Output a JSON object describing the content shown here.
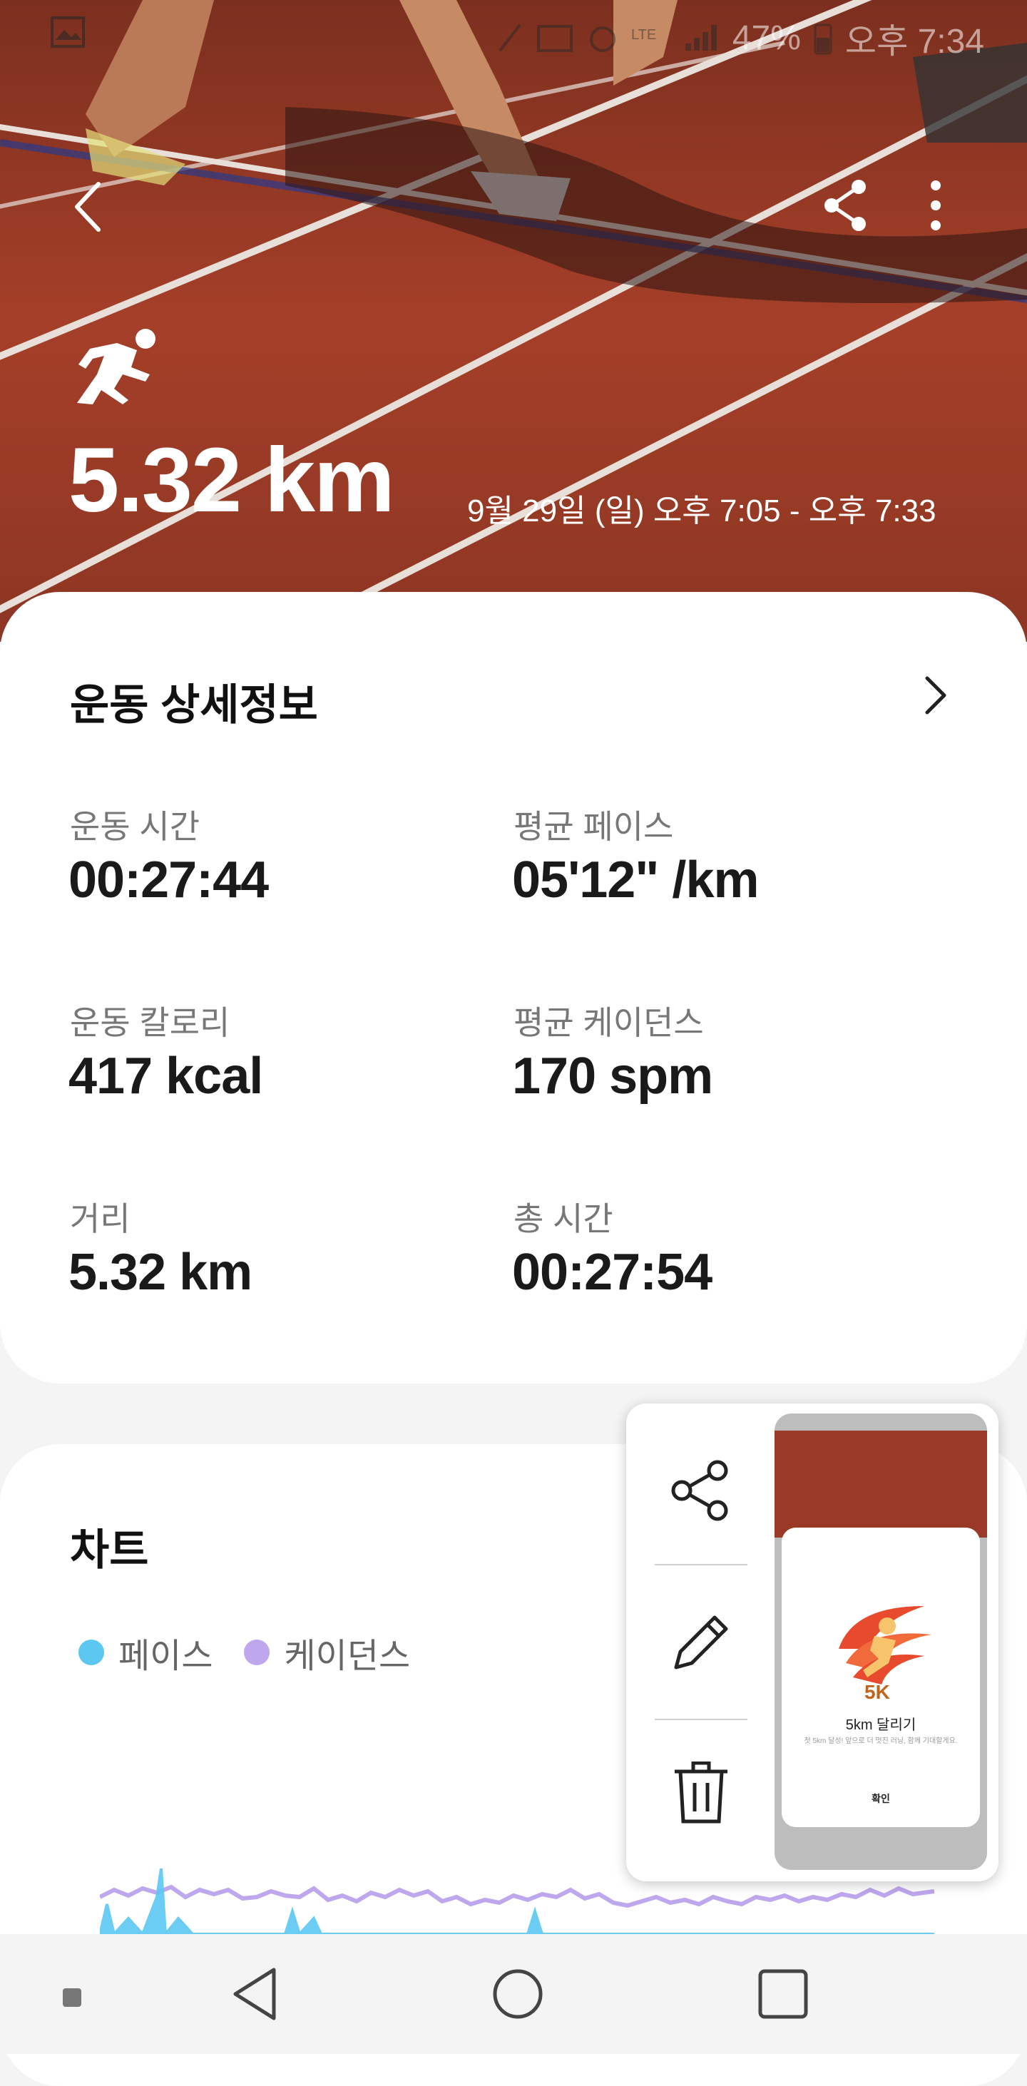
{
  "status_bar": {
    "battery": "47%",
    "time": "오후 7:34"
  },
  "hero": {
    "distance": "5.32 km",
    "date_range": "9월 29일 (일) 오후 7:05 - 오후 7:33",
    "accent": "#a23d28"
  },
  "details": {
    "title": "운동 상세정보",
    "stats": [
      {
        "label": "운동 시간",
        "value": "00:27:44"
      },
      {
        "label": "평균 페이스",
        "value": "05'12\" /km"
      },
      {
        "label": "운동 칼로리",
        "value": "417 kcal"
      },
      {
        "label": "평균 케이던스",
        "value": "170 spm"
      },
      {
        "label": "거리",
        "value": "5.32 km"
      },
      {
        "label": "총 시간",
        "value": "00:27:54"
      }
    ]
  },
  "chart": {
    "title": "차트",
    "legend": [
      {
        "name": "페이스",
        "color": "#5cc8f2"
      },
      {
        "name": "케이던스",
        "color": "#bfa7ee"
      }
    ]
  },
  "screenshot_popup": {
    "actions": [
      "share-icon",
      "pencil-icon",
      "trash-icon"
    ],
    "preview": {
      "badge": "5K",
      "title": "5km 달리기",
      "body": "첫 5km 달성! 앞으로 더 멋진 러닝, 함께 기대할게요.",
      "confirm": "확인"
    }
  },
  "nav": [
    "back",
    "home",
    "recents"
  ]
}
